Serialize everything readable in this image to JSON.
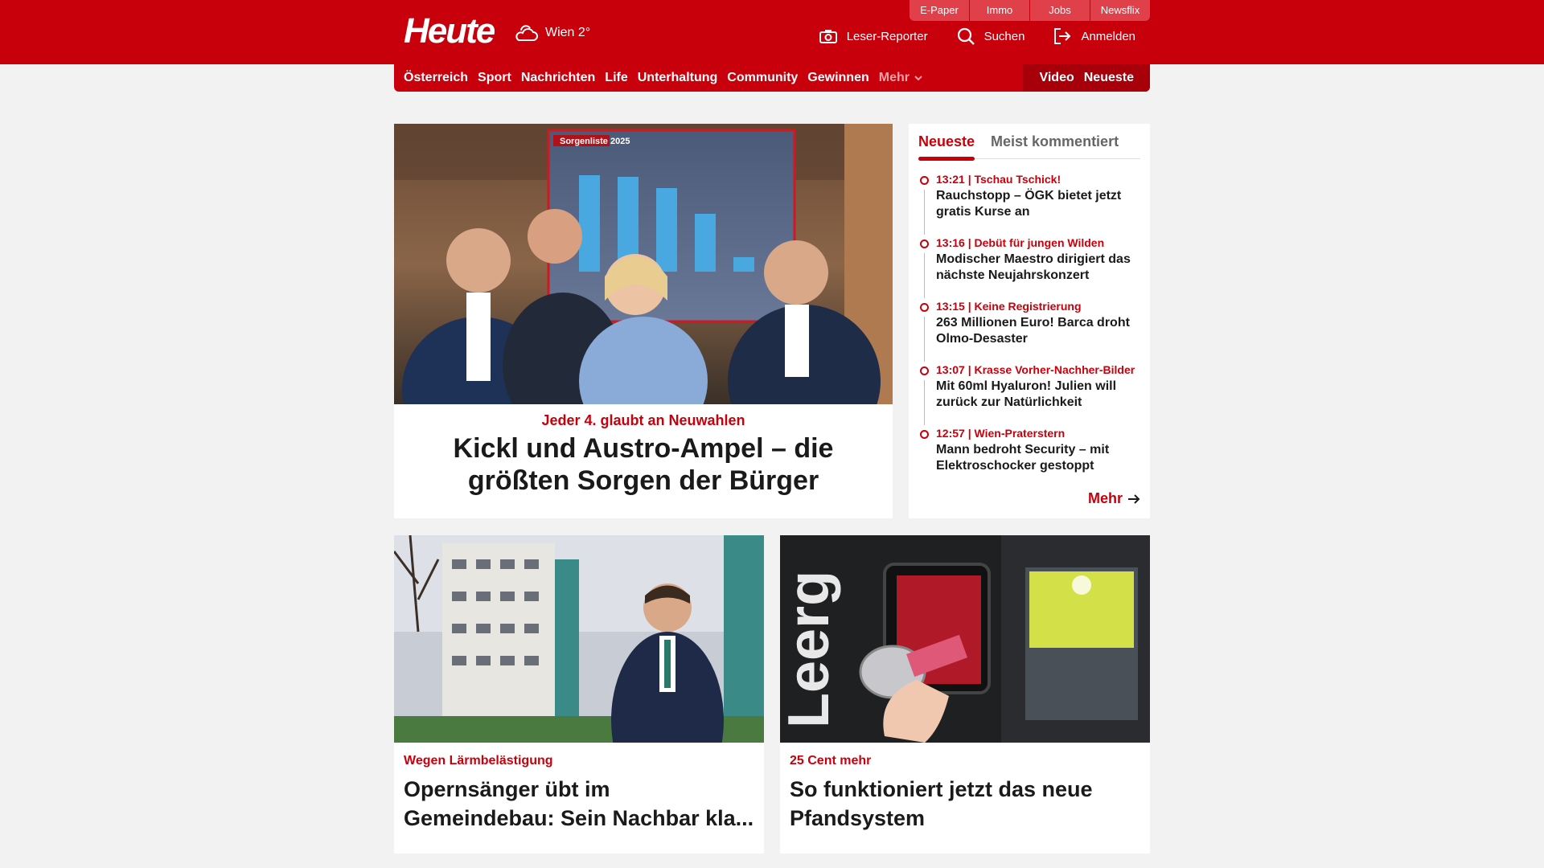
{
  "header": {
    "logo": "Heute",
    "weather": "Wien 2°",
    "toplinks": [
      "E-Paper",
      "Immo",
      "Jobs",
      "Newsflix"
    ],
    "actions": {
      "reporter": "Leser-Reporter",
      "search": "Suchen",
      "login": "Anmelden"
    }
  },
  "nav": {
    "items": [
      "Österreich",
      "Sport",
      "Nachrichten",
      "Life",
      "Unterhaltung",
      "Community",
      "Gewinnen"
    ],
    "more": "Mehr",
    "right": [
      "Video",
      "Neueste"
    ]
  },
  "hero": {
    "image_overlay_title": "Sorgenliste 2025",
    "kicker": "Jeder 4. glaubt an Neuwahlen",
    "title": "Kickl und Austro-Ampel – die größten Sorgen der Bürger"
  },
  "sidebar": {
    "tabs": [
      "Neueste",
      "Meist kommentiert"
    ],
    "items": [
      {
        "meta": "13:21 | Tschau Tschick!",
        "title": "Rauchstopp – ÖGK bietet jetzt gratis Kurse an"
      },
      {
        "meta": "13:16 | Debüt für jungen Wilden",
        "title": "Modischer Maestro dirigiert das nächste Neujahrskonzert"
      },
      {
        "meta": "13:15 | Keine Registrierung",
        "title": "263 Millionen Euro! Barca droht Olmo-Desaster"
      },
      {
        "meta": "13:07 | Krasse Vorher-Nachher-Bilder",
        "title": "Mit 60ml Hyaluron! Julien will zurück zur Natürlichkeit"
      },
      {
        "meta": "12:57 | Wien-Praterstern",
        "title": "Mann bedroht Security – mit Elektroschocker gestoppt"
      }
    ],
    "more": "Mehr"
  },
  "cards": [
    {
      "kicker": "Wegen Lärmbelästigung",
      "title": "Opernsänger übt im Gemeindebau: Sein Nachbar kla..."
    },
    {
      "kicker": "25 Cent mehr",
      "title": "So funktioniert jetzt das neue Pfandsystem",
      "image_text": "Leerg"
    }
  ],
  "colors": {
    "brand": "#c8000c",
    "background": "#f2f2f2"
  }
}
